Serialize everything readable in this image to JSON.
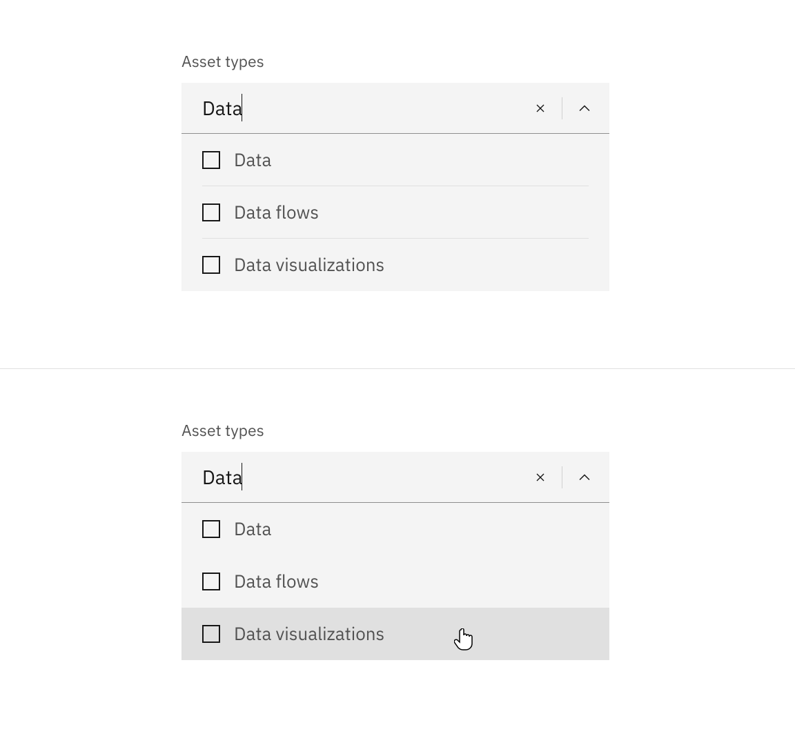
{
  "example1": {
    "label": "Asset types",
    "input_value": "Data",
    "options": [
      {
        "label": "Data",
        "checked": false,
        "hovered": false
      },
      {
        "label": "Data flows",
        "checked": false,
        "hovered": false
      },
      {
        "label": "Data visualizations",
        "checked": false,
        "hovered": false
      }
    ]
  },
  "example2": {
    "label": "Asset types",
    "input_value": "Data",
    "options": [
      {
        "label": "Data",
        "checked": false,
        "hovered": false
      },
      {
        "label": "Data flows",
        "checked": false,
        "hovered": false
      },
      {
        "label": "Data visualizations",
        "checked": false,
        "hovered": true
      }
    ]
  }
}
